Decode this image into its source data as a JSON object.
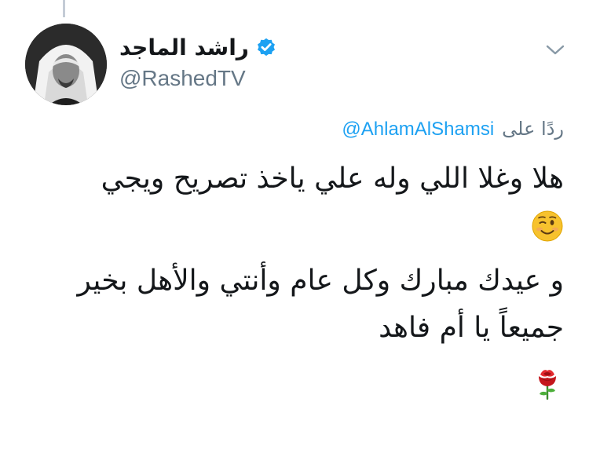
{
  "tweet": {
    "author": {
      "display_name": "راشد الماجد",
      "handle": "@RashedTV",
      "verified": true,
      "avatar_icon": "profile-photo"
    },
    "reply_prefix": "ردًا على",
    "reply_to": "@AhlamAlShamsi",
    "lines": [
      "هلا وغلا اللي وله علي ياخذ تصريح ويجي",
      "و عيدك مبارك وكل عام وأنتي والأهل بخير",
      "جميعاً يا أم فاهد"
    ],
    "emojis": [
      "winking-face",
      "rose"
    ],
    "menu_icon": "chevron-down-icon"
  },
  "colors": {
    "text": "#14171a",
    "secondary": "#657786",
    "link": "#1da1f2",
    "verified": "#1da1f2",
    "thread_line": "#c4ccd6"
  }
}
